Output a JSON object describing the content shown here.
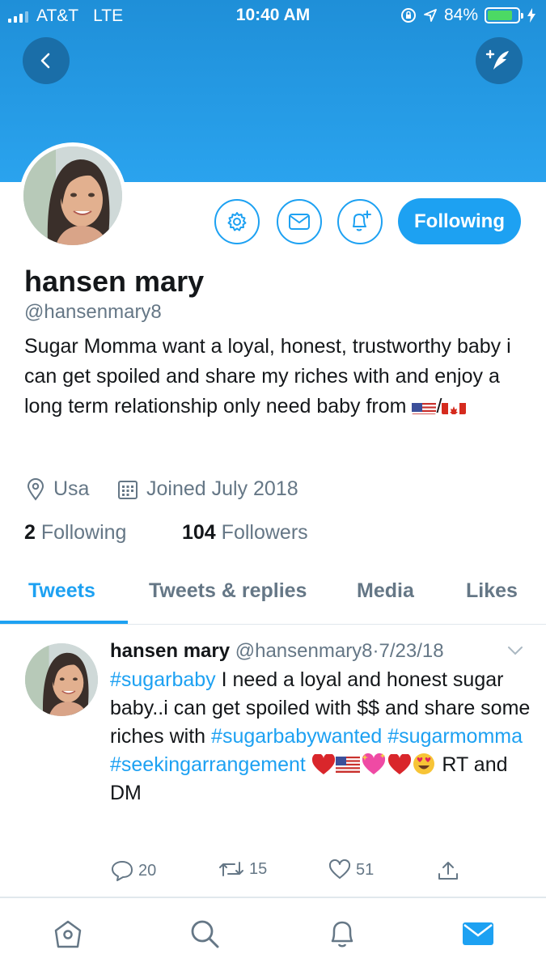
{
  "status_bar": {
    "carrier": "AT&T",
    "network": "LTE",
    "time": "10:40 AM",
    "battery_percent": "84%",
    "battery_level": 0.84
  },
  "profile": {
    "name": "hansen mary",
    "handle": "@hansenmary8",
    "bio_text": "Sugar Momma want a loyal, honest, trustworthy baby i can get spoiled and share my riches with and enjoy a long term relationship only need baby from",
    "bio_separator": "/",
    "location": "Usa",
    "joined": "Joined July 2018",
    "following_count": "2",
    "following_label": "Following",
    "followers_count": "104",
    "followers_label": "Followers",
    "follow_button_label": "Following"
  },
  "tabs": [
    {
      "label": "Tweets",
      "active": true
    },
    {
      "label": "Tweets & replies",
      "active": false
    },
    {
      "label": "Media",
      "active": false
    },
    {
      "label": "Likes",
      "active": false
    }
  ],
  "tweet": {
    "name": "hansen mary",
    "handle": "@hansenmary8",
    "separator": "·",
    "date": "7/23/18",
    "tag1": "#sugarbaby",
    "text1": " I need a loyal and honest sugar baby..i can get spoiled with $$ and share some riches with ",
    "tag2": "#sugarbabywanted",
    "tag3": "#sugarmomma",
    "tag4": "#seekingarrangement",
    "text2": " RT and DM",
    "replies": "20",
    "retweets": "15",
    "likes": "51"
  },
  "icons": {
    "back": "chevron-left-icon",
    "compose": "compose-icon",
    "settings": "gear-icon",
    "message": "envelope-icon",
    "notify": "bell-plus-icon",
    "location": "map-pin-icon",
    "calendar": "calendar-icon",
    "home": "home-icon",
    "search": "search-icon",
    "notifications": "bell-icon",
    "messages": "mail-icon"
  },
  "colors": {
    "accent": "#1da1f2",
    "banner": "#2aa3ee",
    "muted": "#657786",
    "heart": "#e0245e"
  }
}
